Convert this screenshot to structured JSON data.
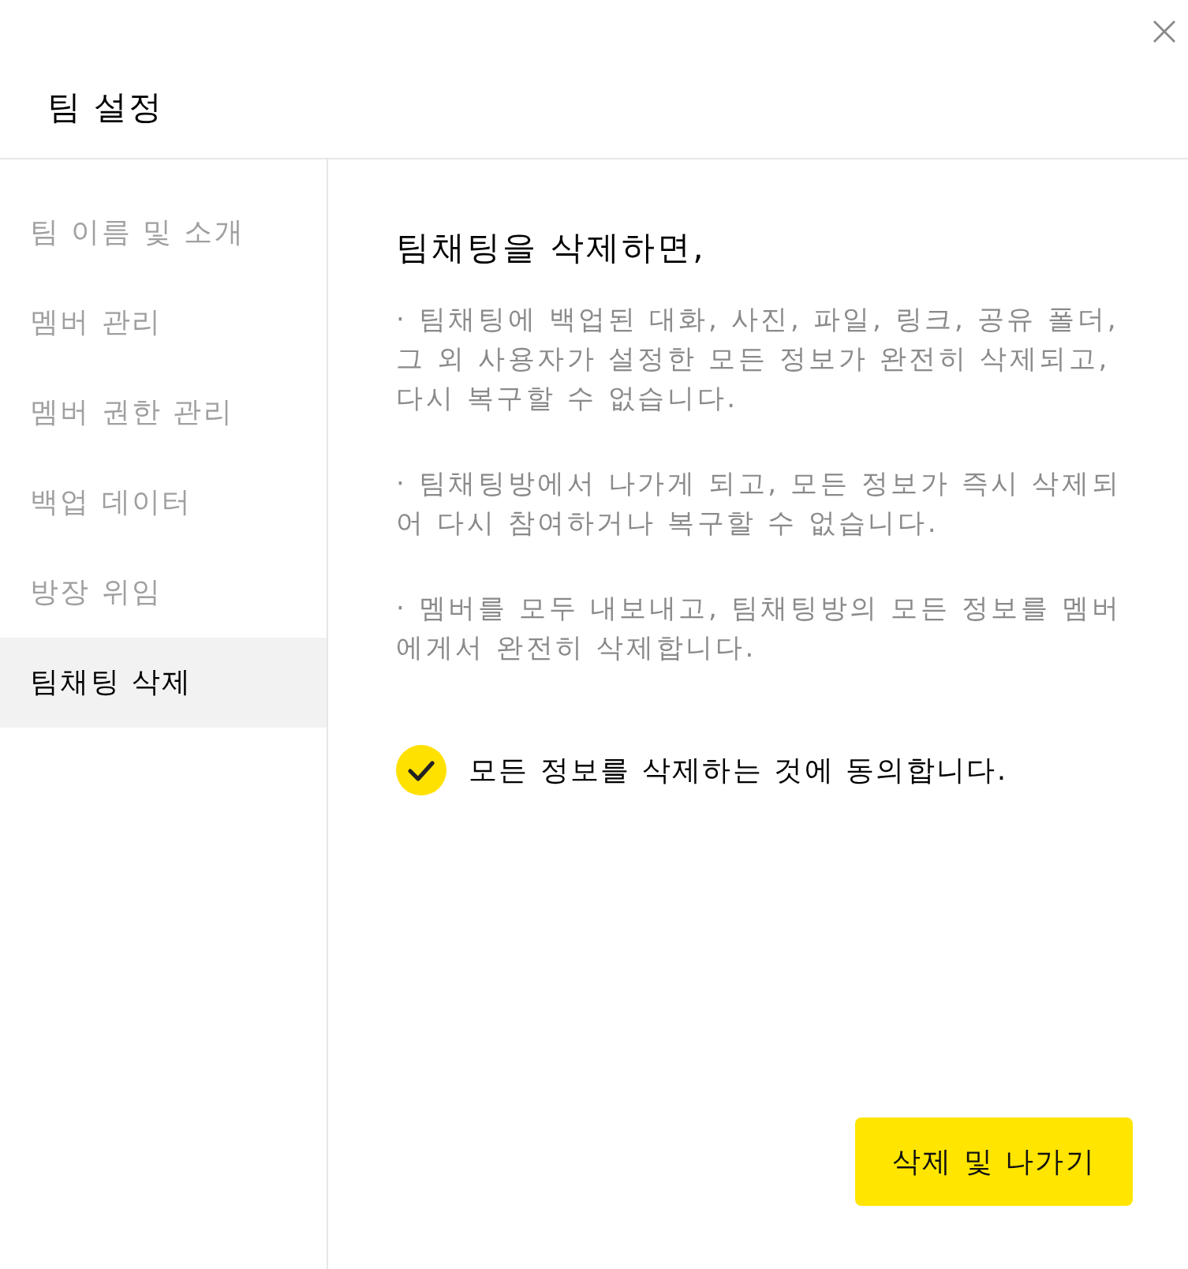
{
  "window": {
    "title": "팀 설정"
  },
  "sidebar": {
    "items": [
      {
        "label": "팀 이름 및 소개",
        "selected": false
      },
      {
        "label": "멤버 관리",
        "selected": false
      },
      {
        "label": "멤버 권한 관리",
        "selected": false
      },
      {
        "label": "백업 데이터",
        "selected": false
      },
      {
        "label": "방장 위임",
        "selected": false
      },
      {
        "label": "팀채팅 삭제",
        "selected": true
      }
    ]
  },
  "content": {
    "heading": "팀채팅을 삭제하면,",
    "paragraphs": [
      "· 팀채팅에 백업된 대화, 사진, 파일, 링크, 공유 폴더, 그 외 사용자가 설정한 모든 정보가 완전히 삭제되고, 다시 복구할 수 없습니다.",
      "· 팀채팅방에서 나가게 되고, 모든 정보가 즉시 삭제되어 다시 참여하거나 복구할 수 없습니다.",
      "· 멤버를 모두 내보내고, 팀채팅방의 모든 정보를 멤버에게서 완전히 삭제합니다."
    ],
    "agreement": {
      "label": "모든 정보를 삭제하는 것에 동의합니다.",
      "checked": true
    }
  },
  "buttons": [
    "삭제 및 나가기"
  ]
}
